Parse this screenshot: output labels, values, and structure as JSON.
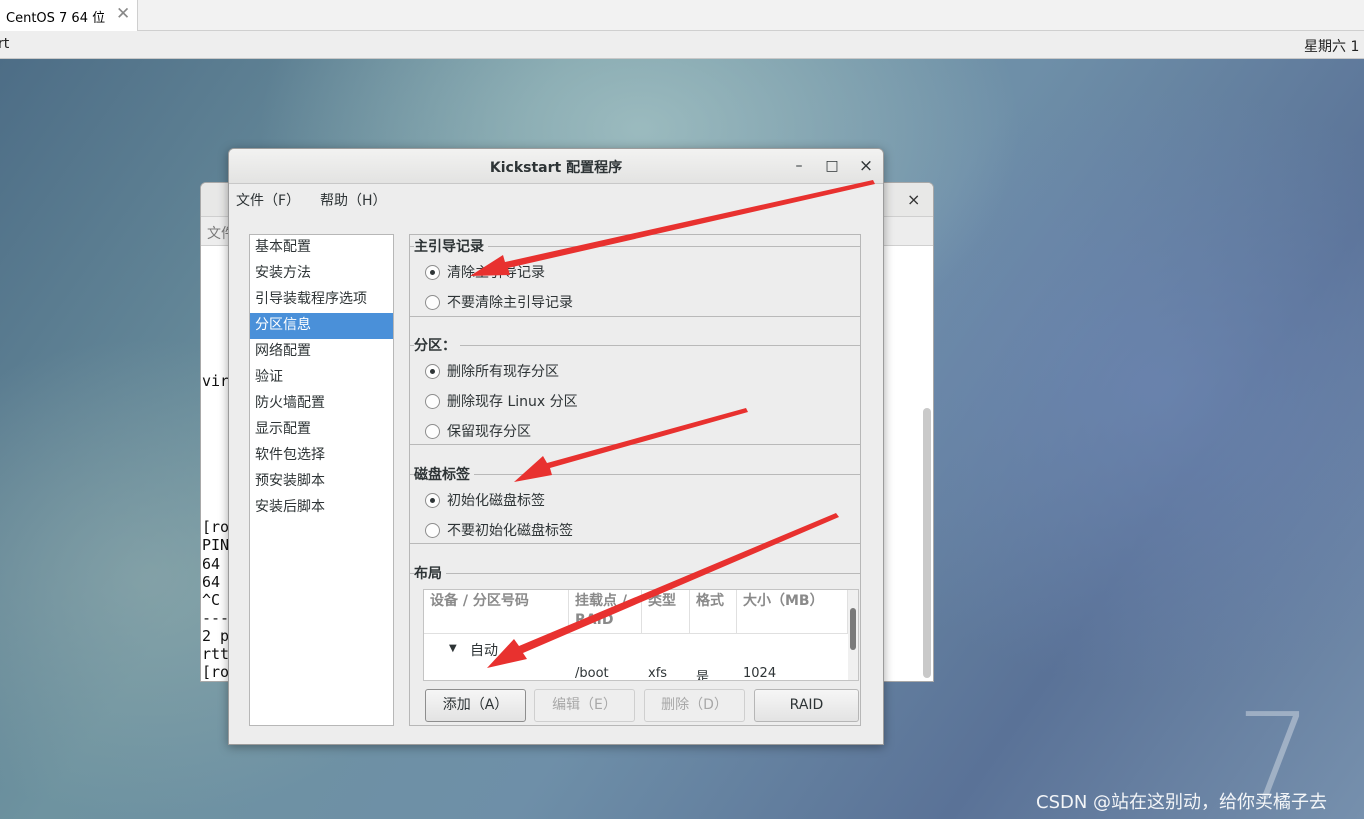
{
  "host": {
    "tab_title": "CentOS 7 64 位",
    "tab_close": "✕"
  },
  "topbar": {
    "activities": "rt",
    "clock": "星期六 1"
  },
  "bg_window": {
    "menu_text": "文件",
    "close": "×",
    "terminal_lines": [
      "vir",
      "[ro",
      "PIN",
      "64 ",
      "64 ",
      "^C ",
      "---",
      "2 p",
      "rtt",
      "[ro"
    ]
  },
  "window": {
    "title": "Kickstart 配置程序",
    "minimize": "–",
    "maximize": "□",
    "close": "×"
  },
  "menu": {
    "file": "文件（F）",
    "help": "帮助（H）"
  },
  "nav": {
    "items": [
      "基本配置",
      "安装方法",
      "引导装载程序选项",
      "分区信息",
      "网络配置",
      "验证",
      "防火墙配置",
      "显示配置",
      "软件包选择",
      "预安装脚本",
      "安装后脚本"
    ],
    "selected": "分区信息"
  },
  "mbr": {
    "title": "主引导记录",
    "options": [
      "清除主引导记录",
      "不要清除主引导记录"
    ],
    "selected": "清除主引导记录"
  },
  "partitions": {
    "title": "分区：",
    "options": [
      "删除所有现存分区",
      "删除现存  Linux 分区",
      "保留现存分区"
    ],
    "selected": "删除所有现存分区"
  },
  "disklabel": {
    "title": "磁盘标签",
    "options": [
      "初始化磁盘标签",
      "不要初始化磁盘标签"
    ],
    "selected": "初始化磁盘标签"
  },
  "layout": {
    "title": "布局",
    "columns": [
      "设备 / 分区号码",
      "挂载点 / RAID",
      "类型",
      "格式",
      "大小（MB）"
    ],
    "group": "自动",
    "rows": [
      {
        "device": "",
        "mount": "/boot",
        "type": "xfs",
        "format": "是",
        "size": "1024"
      }
    ],
    "buttons": {
      "add": "添加（A）",
      "edit": "编辑（E）",
      "delete": "删除（D）",
      "raid": "RAID"
    }
  },
  "desktop": {
    "logo": "7",
    "watermark": "CSDN @站在这别动，给你买橘子去"
  },
  "colors": {
    "selection": "#4a90d9",
    "arrow": "#e8312f"
  }
}
